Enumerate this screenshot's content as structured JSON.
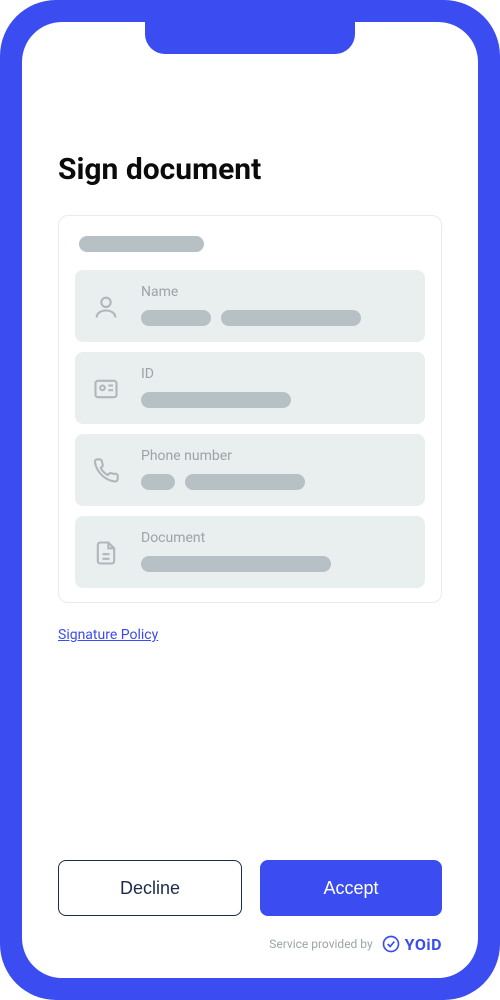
{
  "page": {
    "title": "Sign document"
  },
  "fields": {
    "name": {
      "label": "Name"
    },
    "id": {
      "label": "ID"
    },
    "phone": {
      "label": "Phone number"
    },
    "document": {
      "label": "Document"
    }
  },
  "link": {
    "signature_policy": "Signature Policy"
  },
  "buttons": {
    "decline": "Decline",
    "accept": "Accept"
  },
  "footer": {
    "provided_by": "Service provided by",
    "brand": "YOiD"
  }
}
